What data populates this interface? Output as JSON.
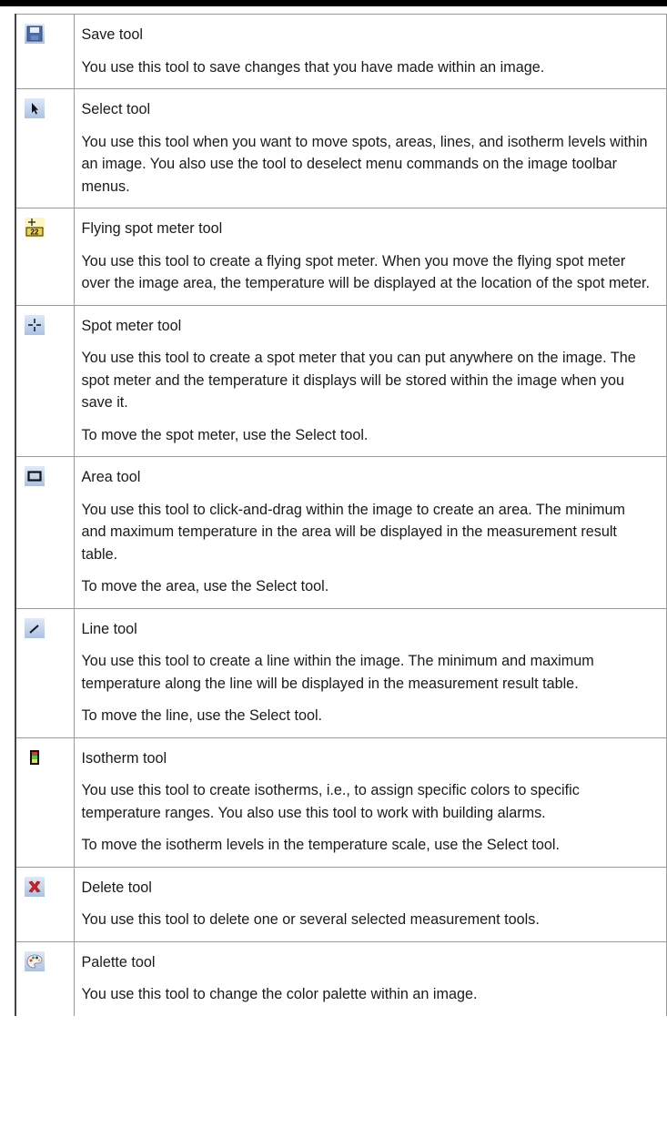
{
  "tools": [
    {
      "icon": "save-icon",
      "name": "Save tool",
      "paragraphs": [
        "You use this tool to save changes that you have made within an image."
      ]
    },
    {
      "icon": "select-arrow-icon",
      "name": "Select tool",
      "paragraphs": [
        "You use this tool when you want to move spots, areas, lines, and isotherm levels within an image. You also use the tool to deselect menu commands on the image toolbar menus."
      ]
    },
    {
      "icon": "flying-spot-meter-icon",
      "name": "Flying spot meter tool",
      "paragraphs": [
        "You use this tool to create a flying spot meter. When you move the flying spot meter over the image area, the temperature will be displayed at the location of the spot meter."
      ]
    },
    {
      "icon": "spot-meter-icon",
      "name": "Spot meter tool",
      "paragraphs": [
        "You use this tool to create a spot meter that you can put anywhere on the image. The spot meter and the temperature it displays will be stored within the image when you save it.",
        "To move the spot meter, use the Select tool."
      ]
    },
    {
      "icon": "area-icon",
      "name": "Area tool",
      "paragraphs": [
        "You use this tool to click-and-drag within the image to create an area. The minimum and maximum temperature in the area will be displayed in the measurement result table.",
        "To move the area, use the Select tool."
      ]
    },
    {
      "icon": "line-icon",
      "name": "Line tool",
      "paragraphs": [
        "You use this tool to create a line within the image. The minimum and maximum temperature along the line will be displayed in the measurement result table.",
        "To move the line, use the Select tool."
      ]
    },
    {
      "icon": "isotherm-icon",
      "name": "Isotherm tool",
      "paragraphs": [
        "You use this tool to create isotherms, i.e., to assign specific colors to specific temperature ranges. You also use this tool to work with building alarms.",
        "To move the isotherm levels in the temperature scale, use the Select tool."
      ]
    },
    {
      "icon": "delete-icon",
      "name": "Delete tool",
      "paragraphs": [
        "You use this tool to delete one or several selected measurement tools."
      ]
    },
    {
      "icon": "palette-icon",
      "name": "Palette tool",
      "paragraphs": [
        "You use this tool to change the color palette within an image."
      ]
    }
  ],
  "flying_spot_icon_text": "22"
}
